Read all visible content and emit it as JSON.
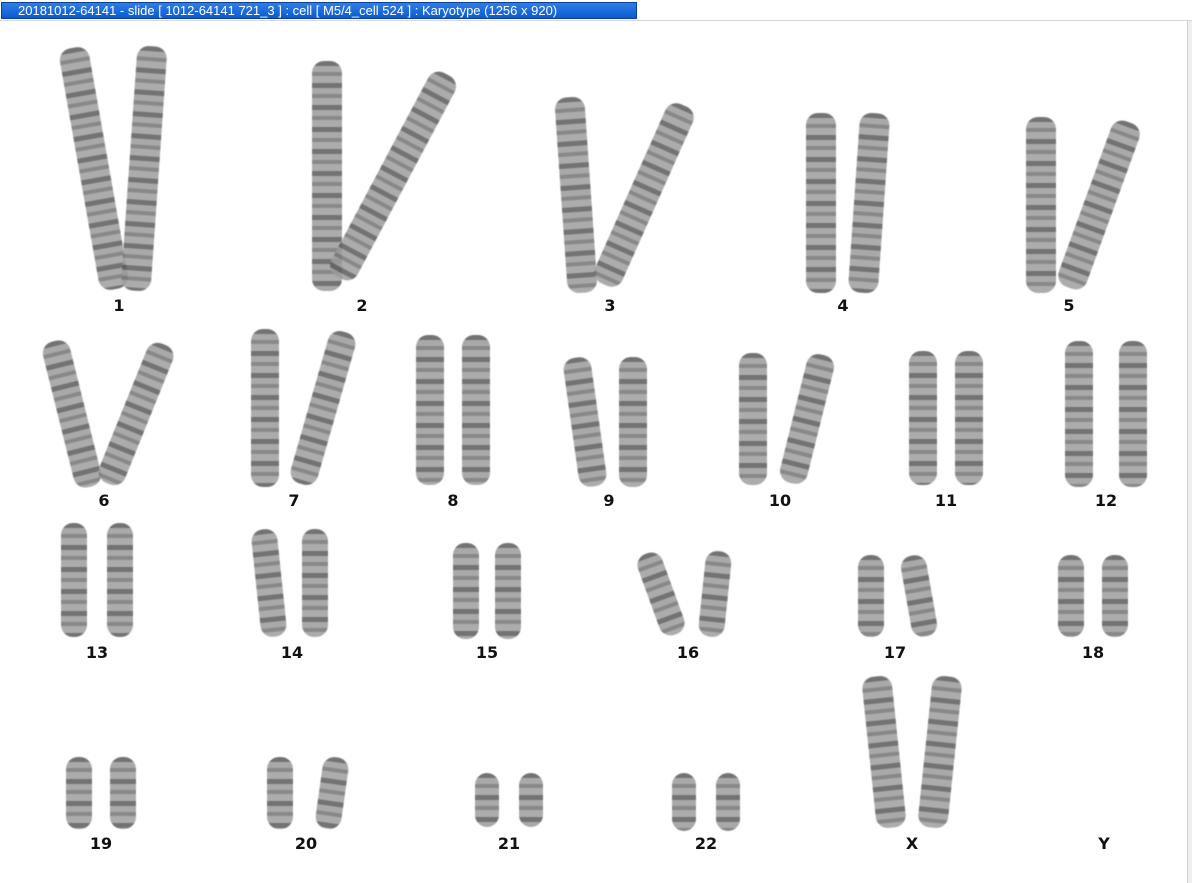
{
  "window": {
    "title": "20181012-64141 - slide [ 1012-64141 721_3 ] : cell [ M5/4_cell 524 ] : Karyotype  (1256 x 920)"
  },
  "karyotype": {
    "labels": [
      "1",
      "2",
      "3",
      "4",
      "5",
      "6",
      "7",
      "8",
      "9",
      "10",
      "11",
      "12",
      "13",
      "14",
      "15",
      "16",
      "17",
      "18",
      "19",
      "20",
      "21",
      "22",
      "X",
      "Y"
    ]
  }
}
